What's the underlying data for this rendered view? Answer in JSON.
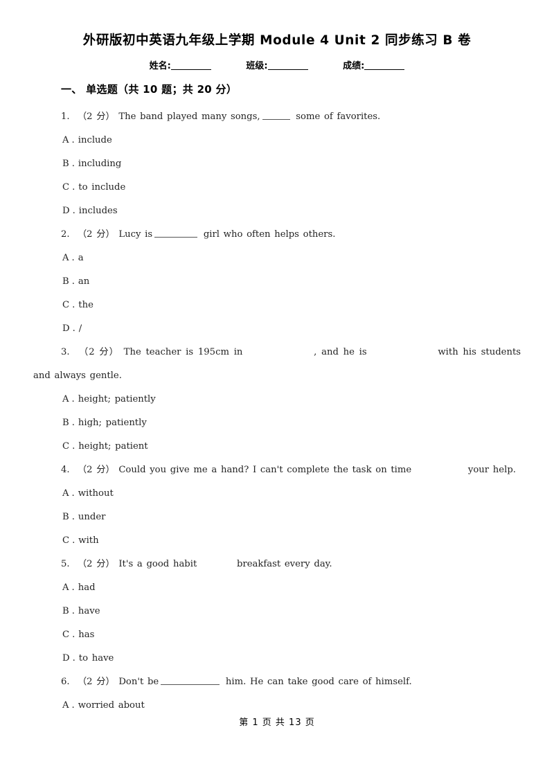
{
  "document": {
    "title": "外研版初中英语九年级上学期 Module 4 Unit 2 同步练习 B 卷",
    "fields": [
      {
        "label": "姓名:",
        "value": ""
      },
      {
        "label": "班级:",
        "value": ""
      },
      {
        "label": "成绩:",
        "value": ""
      }
    ],
    "footer": "第 1 页 共 13 页"
  },
  "section": {
    "heading": "一、 单选题（共 10 题；共 20 分）"
  },
  "questions": [
    {
      "number": "1.",
      "score": "（2 分）",
      "stem_parts": [
        {
          "type": "text",
          "value": "The band played many songs,"
        },
        {
          "type": "blank",
          "size": "short"
        },
        {
          "type": "text",
          "value": "some of favorites."
        }
      ],
      "stem_plain": "The band played many songs, ______ some of favorites.",
      "options": [
        {
          "letter": "A",
          "sep": ".",
          "text": "include"
        },
        {
          "letter": "B",
          "sep": ".",
          "text": "including"
        },
        {
          "letter": "C",
          "sep": ".",
          "text": "to include"
        },
        {
          "letter": "D",
          "sep": ".",
          "text": "includes"
        }
      ]
    },
    {
      "number": "2.",
      "score": "（2 分）",
      "stem_parts": [
        {
          "type": "text",
          "value": "Lucy is"
        },
        {
          "type": "blank",
          "size": "mid"
        },
        {
          "type": "text",
          "value": "girl who often helps others."
        }
      ],
      "stem_plain": "Lucy is _________ girl who often helps others.",
      "options": [
        {
          "letter": "A",
          "sep": ".",
          "text": "a"
        },
        {
          "letter": "B",
          "sep": ".",
          "text": "an"
        },
        {
          "letter": "C",
          "sep": ".",
          "text": "the"
        },
        {
          "letter": "D",
          "sep": ".",
          "text": "/"
        }
      ]
    },
    {
      "number": "3.",
      "score": "（2 分）",
      "stem_parts": [
        {
          "type": "text",
          "value": "The teacher is 195cm in"
        },
        {
          "type": "gap",
          "size": "lg"
        },
        {
          "type": "text",
          "value": ", and he is"
        },
        {
          "type": "gap",
          "size": "lg"
        },
        {
          "type": "text",
          "value": "with his students and always gentle."
        }
      ],
      "stem_plain": "The teacher is 195cm in , and he is with his students and always gentle.",
      "options": [
        {
          "letter": "A",
          "sep": ".",
          "text": "height; patiently"
        },
        {
          "letter": "B",
          "sep": ".",
          "text": "high; patiently"
        },
        {
          "letter": "C",
          "sep": ".",
          "text": "height; patient"
        }
      ]
    },
    {
      "number": "4.",
      "score": "（2 分）",
      "stem_parts": [
        {
          "type": "text",
          "value": "Could you give me a hand? I can't complete the task on time"
        },
        {
          "type": "gap",
          "size": "md"
        },
        {
          "type": "text",
          "value": "your help."
        }
      ],
      "stem_plain": "Could you give me a hand? I can't complete the task on time your help.",
      "options": [
        {
          "letter": "A",
          "sep": ".",
          "text": "without"
        },
        {
          "letter": "B",
          "sep": ".",
          "text": "under"
        },
        {
          "letter": "C",
          "sep": ".",
          "text": "with"
        }
      ]
    },
    {
      "number": "5.",
      "score": "（2 分）",
      "stem_parts": [
        {
          "type": "text",
          "value": "It's a good habit"
        },
        {
          "type": "gap",
          "size": "sm"
        },
        {
          "type": "text",
          "value": "breakfast every day."
        }
      ],
      "stem_plain": "It's a good habit breakfast every day.",
      "options": [
        {
          "letter": "A",
          "sep": ".",
          "text": "had"
        },
        {
          "letter": "B",
          "sep": ".",
          "text": "have"
        },
        {
          "letter": "C",
          "sep": ".",
          "text": "has"
        },
        {
          "letter": "D",
          "sep": ".",
          "text": "to have"
        }
      ]
    },
    {
      "number": "6.",
      "score": "（2 分）",
      "stem_parts": [
        {
          "type": "text",
          "value": "Don't be"
        },
        {
          "type": "blank",
          "size": "long"
        },
        {
          "type": "text",
          "value": "him. He can take good care of himself."
        }
      ],
      "stem_plain": "Don't be ___________ him. He can take good care of himself.",
      "options": [
        {
          "letter": "A",
          "sep": ".",
          "text": "worried about"
        }
      ]
    }
  ]
}
